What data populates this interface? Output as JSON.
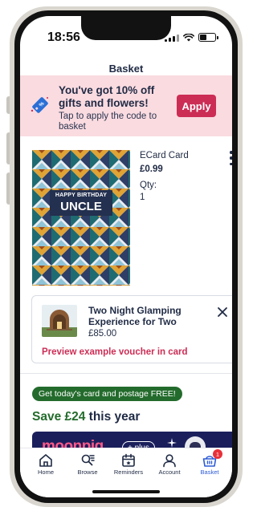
{
  "status_bar": {
    "time": "18:56"
  },
  "header": {
    "title": "Basket"
  },
  "promo": {
    "icon": "gift-tag-icon",
    "title": "You've got 10% off gifts and flowers!",
    "subtitle": "Tap to apply the code to basket",
    "apply_label": "Apply"
  },
  "basket_item": {
    "card_text_line1": "HAPPY BIRTHDAY",
    "card_text_line2": "UNCLE",
    "name": "ECard Card",
    "price": "£0.99",
    "qty_label": "Qty:",
    "qty_value": "1"
  },
  "gift": {
    "title": "Two Night Glamping Experience for Two",
    "price": "£85.00",
    "preview_link": "Preview example voucher in card"
  },
  "offer": {
    "pill_text": "Get today's card and postage FREE!",
    "save_prefix": "Save £24",
    "save_suffix": " this year",
    "banner_logo": "moonpig",
    "banner_plus": "+ plus"
  },
  "tabbar": {
    "items": [
      {
        "label": "Home",
        "icon": "home-icon"
      },
      {
        "label": "Browse",
        "icon": "browse-icon"
      },
      {
        "label": "Reminders",
        "icon": "calendar-icon"
      },
      {
        "label": "Account",
        "icon": "account-icon"
      },
      {
        "label": "Basket",
        "icon": "basket-icon",
        "badge": "1"
      }
    ]
  },
  "colors": {
    "brand_red": "#cc2d55",
    "promo_bg": "#fadbe0",
    "navy": "#1f2a44",
    "green": "#236b2c",
    "active_tab": "#2c5bd6"
  }
}
